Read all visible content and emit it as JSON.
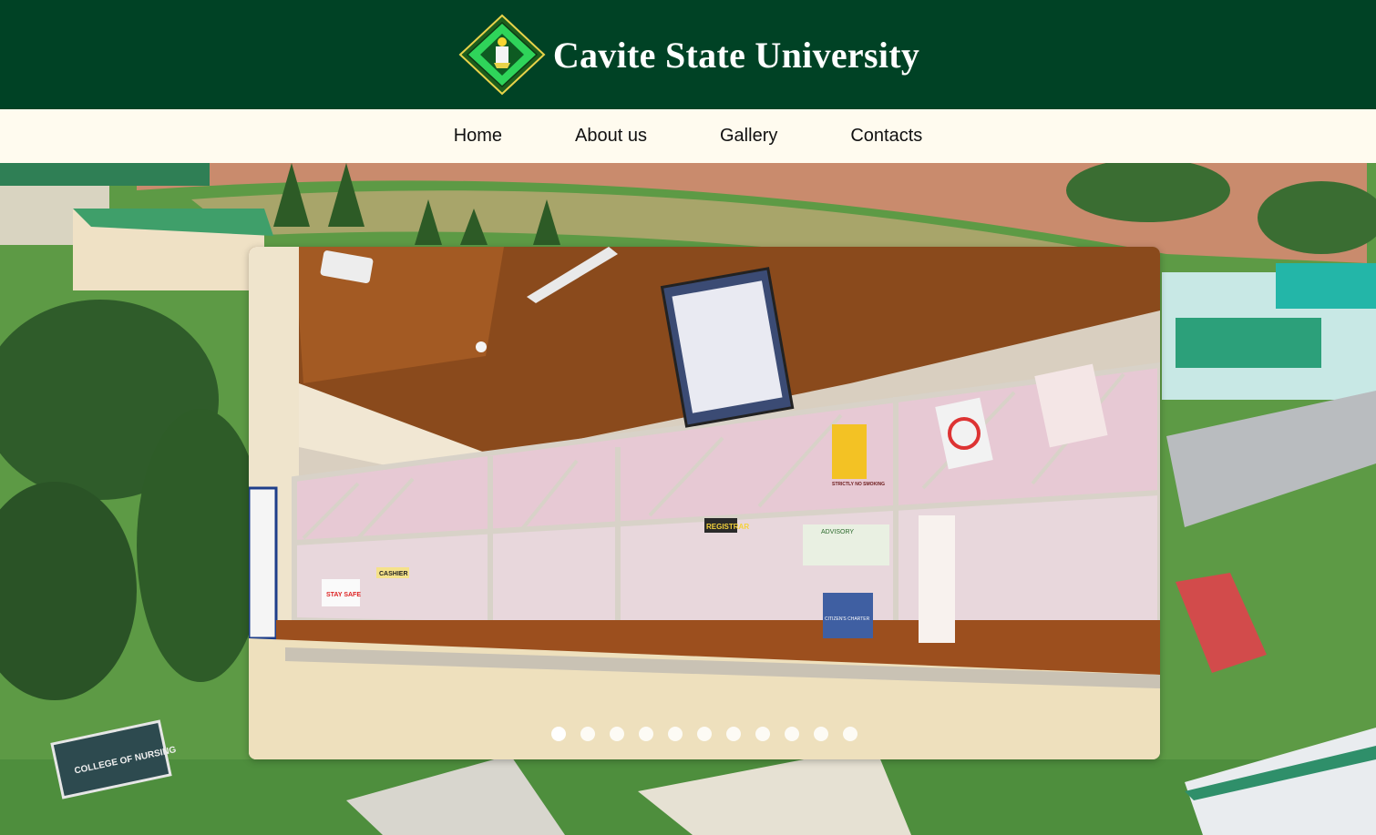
{
  "header": {
    "title": "Cavite State University",
    "logo_icon": "cvsu-seal-icon",
    "bg_color": "#004225"
  },
  "nav": {
    "items": [
      {
        "label": "Home"
      },
      {
        "label": "About us"
      },
      {
        "label": "Gallery"
      },
      {
        "label": "Contacts"
      }
    ],
    "bg_color": "#fffbef"
  },
  "carousel": {
    "slide_count": 11,
    "active_slide": 1,
    "slide_signs": {
      "registrar": "REGISTRAR",
      "cashier": "CASHIER",
      "advisory": "ADVISORY",
      "no_smoking": "STRICTLY NO SMOKING",
      "citizens_charter": "CITIZEN'S CHARTER",
      "stay_safe": "STAY SAFE"
    }
  },
  "background": {
    "signboard": "COLLEGE OF NURSING"
  }
}
